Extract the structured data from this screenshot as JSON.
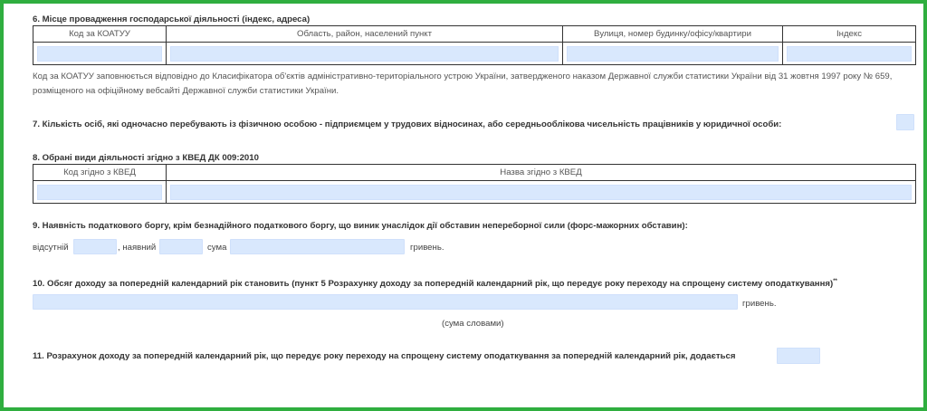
{
  "colors": {
    "frame_border": "#2fae3f",
    "field_fill": "#d9e8fd",
    "table_border": "#333333"
  },
  "section6": {
    "title": "6. Місце провадження господарської діяльності (індекс, адреса)",
    "columns": [
      "Код за КОАТУУ",
      "Область, район, населений пункт",
      "Вулиця, номер будинку/офісу/квартири",
      "Індекс"
    ],
    "note": "Код за КОАТУУ заповнюється відповідно до Класифікатора об'єктів адміністративно-територіального устрою України, затвердженого наказом Державної служби статистики України від 31 жовтня 1997 року № 659, розміщеного на офіційному вебсайті Державної служби статистики України."
  },
  "section7": {
    "title": "7. Кількість осіб, які одночасно перебувають із фізичною особою - підприємцем у трудових відносинах, або середньооблікова чисельність працівників у юридичної особи:"
  },
  "section8": {
    "title": "8. Обрані види діяльності згідно з КВЕД ДК 009:2010",
    "columns": [
      "Код згідно з КВЕД",
      "Назва згідно з КВЕД"
    ]
  },
  "section9": {
    "title": "9. Наявність податкового боргу, крім безнадійного податкового боргу, що виник унаслідок дії обставин непереборної сили (форс-мажорних обставин):",
    "absent_label": "відсутній",
    "present_label": ", наявний",
    "sum_label": "сума",
    "currency_label": "гривень."
  },
  "section10": {
    "title": "10. Обсяг доходу за попередній календарний рік становить (пункт 5 Розрахунку доходу за попередній календарний рік, що передує року переходу на спрощену систему оподаткування)",
    "footnote_mark": "**",
    "currency_label": "гривень.",
    "sum_words_label": "(сума словами)"
  },
  "section11": {
    "title": "11. Розрахунок доходу за попередній календарний рік, що передує року переходу на спрощену систему оподаткування за попередній календарний рік, додається"
  }
}
